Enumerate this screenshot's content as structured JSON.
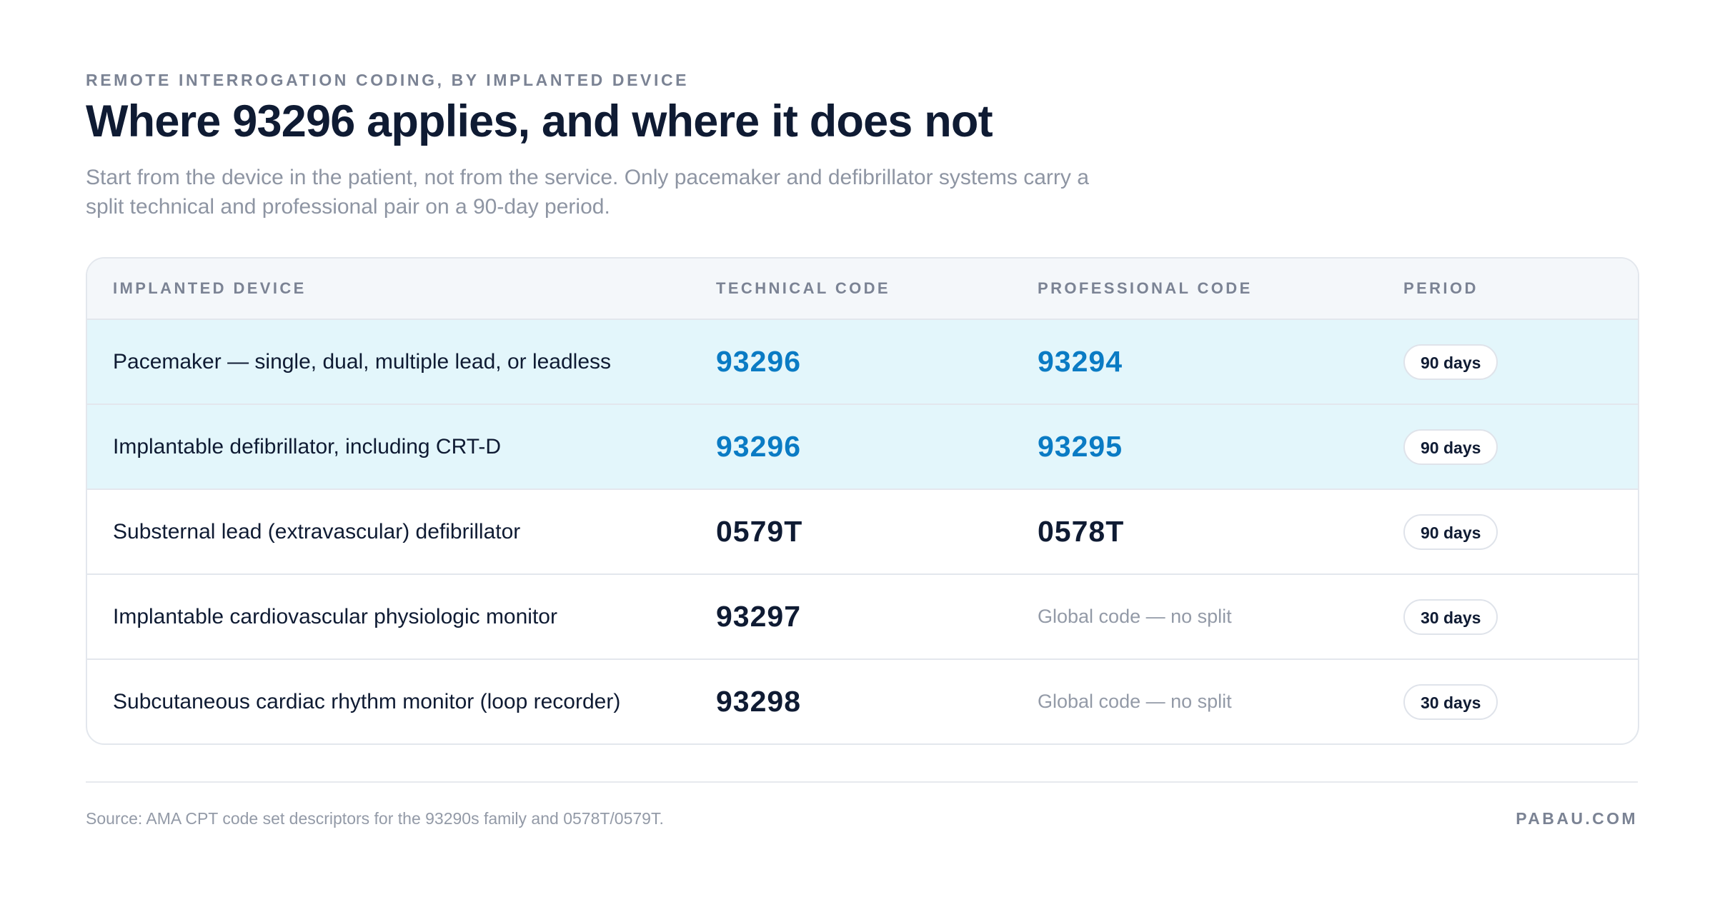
{
  "header": {
    "eyebrow": "REMOTE INTERROGATION CODING, BY IMPLANTED DEVICE",
    "title": "Where 93296 applies, and where it does not",
    "subtitle": "Start from the device in the patient, not from the service. Only pacemaker and defibrillator systems carry a split technical and professional pair on a 90-day period."
  },
  "table": {
    "columns": [
      "IMPLANTED DEVICE",
      "TECHNICAL CODE",
      "PROFESSIONAL CODE",
      "PERIOD"
    ],
    "rows": [
      {
        "device": "Pacemaker — single, dual, multiple lead, or leadless",
        "technical": "93296",
        "professional": "93294",
        "period": "90 days",
        "highlight": true
      },
      {
        "device": "Implantable defibrillator, including CRT-D",
        "technical": "93296",
        "professional": "93295",
        "period": "90 days",
        "highlight": true
      },
      {
        "device": "Substernal lead (extravascular) defibrillator",
        "technical": "0579T",
        "professional": "0578T",
        "period": "90 days",
        "highlight": false
      },
      {
        "device": "Implantable cardiovascular physiologic monitor",
        "technical": "93297",
        "professional": "Global code — no split",
        "period": "30 days",
        "highlight": false
      },
      {
        "device": "Subcutaneous cardiac rhythm monitor (loop recorder)",
        "technical": "93298",
        "professional": "Global code — no split",
        "period": "30 days",
        "highlight": false
      }
    ]
  },
  "footer": {
    "source": "Source: AMA CPT code set descriptors for the 93290s family and 0578T/0579T.",
    "brand": "PABAU.COM"
  },
  "colors": {
    "highlight_row": "#e3f6fb",
    "highlight_code": "#0a7bc4",
    "text_primary": "#0f1b33",
    "text_muted": "#8e95a3"
  }
}
